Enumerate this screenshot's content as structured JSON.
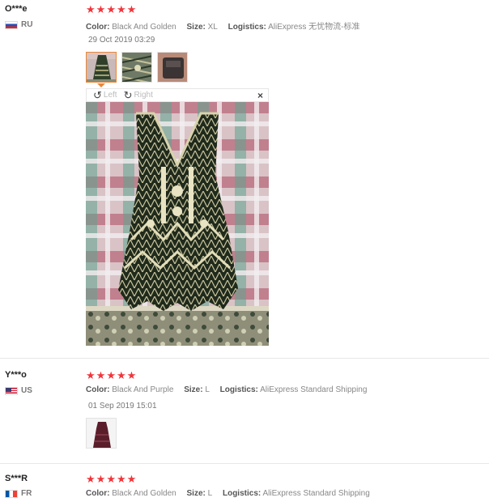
{
  "reviews": [
    {
      "user": "O***e",
      "country": "RU",
      "rating": 5,
      "attributes": {
        "color_label": "Color:",
        "color": "Black And Golden",
        "size_label": "Size:",
        "size": "XL",
        "logistics_label": "Logistics:",
        "logistics": "AliExpress 无忧物流-标准"
      },
      "date": "29 Oct 2019 03:29",
      "viewer": {
        "rotate_left": "Left",
        "rotate_right": "Right",
        "close_icon": "×"
      }
    },
    {
      "user": "Y***o",
      "country": "US",
      "rating": 5,
      "attributes": {
        "color_label": "Color:",
        "color": "Black And Purple",
        "size_label": "Size:",
        "size": "L",
        "logistics_label": "Logistics:",
        "logistics": "AliExpress Standard Shipping"
      },
      "date": "01 Sep 2019 15:01"
    },
    {
      "user": "S***R",
      "country": "FR",
      "rating": 5,
      "attributes": {
        "color_label": "Color:",
        "color": "Black And Golden",
        "size_label": "Size:",
        "size": "L",
        "logistics_label": "Logistics:",
        "logistics": "AliExpress Standard Shipping"
      }
    }
  ],
  "colors": {
    "star": "#f0353b",
    "active_thumb_border": "#e8873a"
  }
}
